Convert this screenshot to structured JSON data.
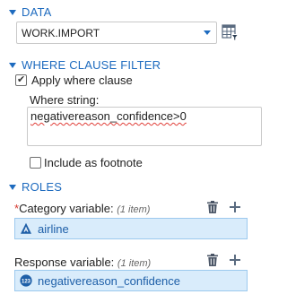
{
  "data_section": {
    "title": "DATA",
    "dataset": "WORK.IMPORT"
  },
  "where_section": {
    "title": "WHERE CLAUSE FILTER",
    "apply_label": "Apply where clause",
    "apply_checked": true,
    "where_label": "Where string:",
    "where_value": "negativereason_confidence>0",
    "footnote_label": "Include as footnote",
    "footnote_checked": false
  },
  "roles_section": {
    "title": "ROLES",
    "category": {
      "required_marker": "*",
      "label": "Category variable:",
      "count": "(1 item)",
      "value": "airline",
      "value_type_icon": "character-variable-icon"
    },
    "response": {
      "label": "Response variable:",
      "count": "(1 item)",
      "value": "negativereason_confidence",
      "value_type_icon": "numeric-variable-icon",
      "value_type_glyph": "123"
    }
  },
  "colors": {
    "accent": "#1e6bbf",
    "selection_bg": "#d9ecfb",
    "required": "#d6382e"
  }
}
